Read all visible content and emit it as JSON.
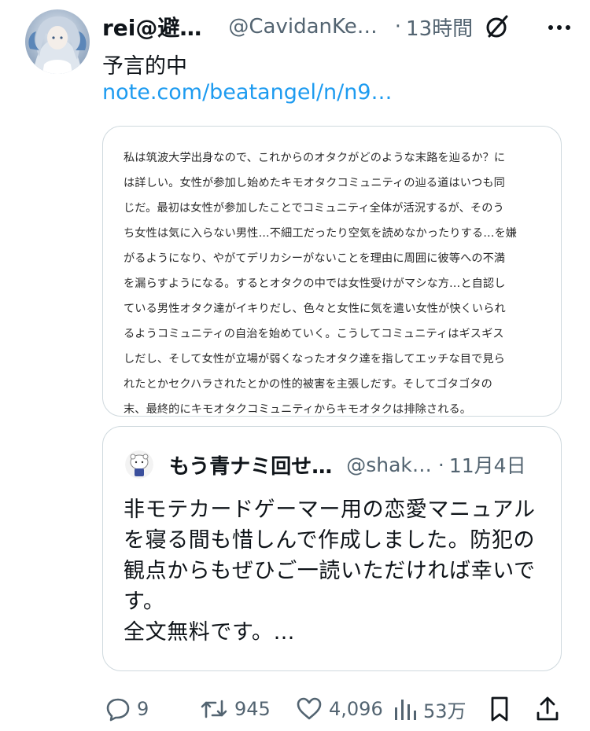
{
  "tweet": {
    "author_name": "rei@避…",
    "handle": "@CavidanKe…",
    "separator": "·",
    "time": "13時間",
    "text": "予言的中",
    "link_text": "note.com/beatangel/n/n9…"
  },
  "card": {
    "lines": [
      "私は筑波大学出身なので、これからのオタクがどのような末路を辿るか？に",
      "は詳しい。女性が参加し始めたキモオタクコミュニティの辿る道はいつも同",
      "じだ。最初は女性が参加したことでコミュニティ全体が活況するが、そのう",
      "ち女性は気に入らない男性…不細工だったり空気を読めなかったりする…を嫌",
      "がるようになり、やがてデリカシーがないことを理由に周囲に彼等への不満",
      "を漏らすようになる。するとオタクの中では女性受けがマシな方…と自認し",
      "ている男性オタク達がイキりだし、色々と女性に気を遣い女性が快くいられ",
      "るようコミュニティの自治を始めていく。こうしてコミュニティはギスギス",
      "しだし、そして女性が立場が弱くなったオタク達を指してエッチな目で見ら",
      "れたとかセクハラされたとかの性的被害を主張しだす。そしてゴタゴタの",
      "末、最終的にキモオタクコミュニティからキモオタクは排除される。"
    ]
  },
  "quote": {
    "author_name": "もう青ナミ回せ…",
    "handle": "@shak…",
    "separator": "·",
    "date": "11月4日",
    "lines": [
      "非モテカードゲーマー用の恋愛マニュアル",
      "を寝る間も惜しんで作成しました。防犯の",
      "観点からもぜひご一読いただければ幸いで",
      "す。",
      "全文無料です。…"
    ]
  },
  "actions": {
    "replies": "9",
    "retweets": "945",
    "likes": "4,096",
    "views": "53万"
  },
  "colors": {
    "link": "#1d9bf0",
    "secondary_text": "#536471",
    "border": "#cfd9de"
  }
}
